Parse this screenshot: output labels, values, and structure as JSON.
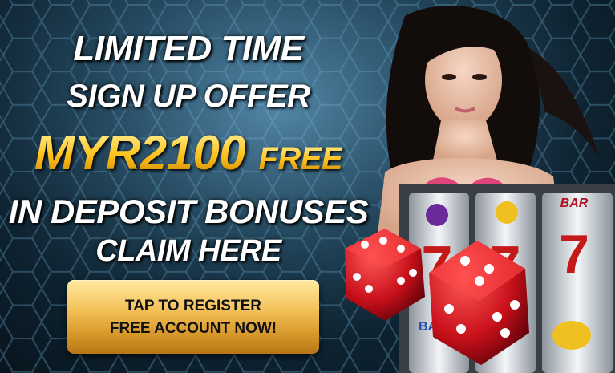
{
  "promo": {
    "line1": "LIMITED TIME",
    "line2": "SIGN UP OFFER",
    "amount": "MYR2100",
    "free": "FREE",
    "line4": "IN DEPOSIT BONUSES",
    "line5": "CLAIM HERE"
  },
  "cta": {
    "line1": "TAP TO REGISTER",
    "line2": "FREE ACCOUNT NOW!"
  },
  "slot_reels": [
    "BAR",
    "7",
    "BAR"
  ],
  "colors": {
    "gold": "#ffc21a",
    "dice": "#c8101a",
    "bg": "#1d4258"
  }
}
